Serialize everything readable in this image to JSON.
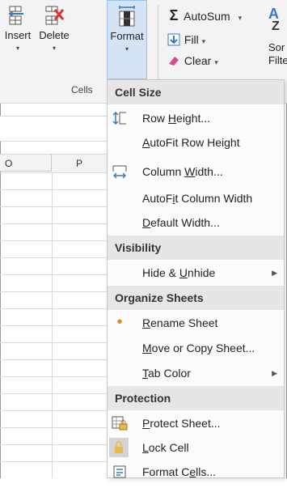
{
  "ribbon": {
    "insert_label": "Insert",
    "delete_label": "Delete",
    "format_label": "Format",
    "cells_group_label": "Cells",
    "autosum_label": "AutoSum",
    "fill_label": "Fill",
    "clear_label": "Clear",
    "sort_label_top": "Sor",
    "sort_label_bottom": "Filte",
    "dropdown_caret": "▾"
  },
  "grid": {
    "columns": [
      "O",
      "P"
    ]
  },
  "menu": {
    "sections": {
      "cell_size": "Cell Size",
      "visibility": "Visibility",
      "organize": "Organize Sheets",
      "protection": "Protection"
    },
    "items": {
      "row_height": {
        "pre": "Row ",
        "u": "H",
        "post": "eight..."
      },
      "autofit_row": {
        "pre": "",
        "u": "A",
        "post": "utoFit Row Height"
      },
      "column_width": {
        "pre": "Column ",
        "u": "W",
        "post": "idth..."
      },
      "autofit_col": {
        "pre": "AutoF",
        "u": "i",
        "post": "t Column Width"
      },
      "default_width": {
        "pre": "",
        "u": "D",
        "post": "efault Width..."
      },
      "hide_unhide": {
        "pre": "Hide & ",
        "u": "U",
        "post": "nhide"
      },
      "rename_sheet": {
        "pre": "",
        "u": "R",
        "post": "ename Sheet"
      },
      "move_copy": {
        "pre": "",
        "u": "M",
        "post": "ove or Copy Sheet..."
      },
      "tab_color": {
        "pre": "",
        "u": "T",
        "post": "ab Color"
      },
      "protect_sheet": {
        "pre": "",
        "u": "P",
        "post": "rotect Sheet..."
      },
      "lock_cell": {
        "pre": "",
        "u": "L",
        "post": "ock Cell"
      },
      "format_cells": {
        "pre": "Format C",
        "u": "e",
        "post": "lls..."
      }
    },
    "submenu_arrow": "▶",
    "bullet": "•"
  },
  "colors": {
    "active_button_bg": "#d4e4f5",
    "section_bg": "#e6e6e6",
    "bullet": "#e08a1e",
    "lock_icon": "#e8b84a",
    "autosum_icon": "#333333",
    "clear_icon": "#d64b8a",
    "fill_icon": "#3a78c2"
  }
}
